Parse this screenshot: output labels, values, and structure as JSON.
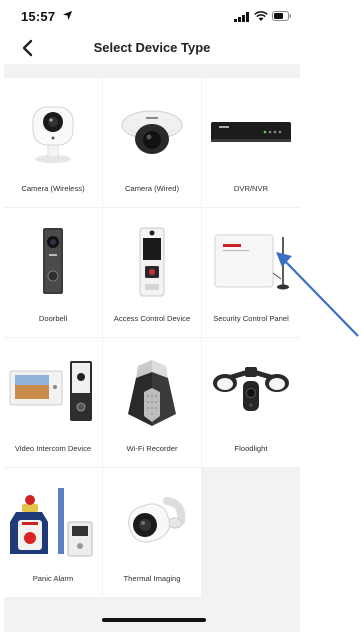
{
  "status_bar": {
    "time": "15:57",
    "location_icon": "location-arrow-icon",
    "signal_icon": "cellular-signal-icon",
    "wifi_icon": "wifi-icon",
    "battery_icon": "battery-icon"
  },
  "nav": {
    "back_icon": "chevron-left-icon",
    "title": "Select Device Type"
  },
  "devices": [
    {
      "label": "Camera (Wireless)",
      "icon": "wireless-camera-icon"
    },
    {
      "label": "Camera (Wired)",
      "icon": "dome-camera-icon"
    },
    {
      "label": "DVR/NVR",
      "icon": "dvr-nvr-icon"
    },
    {
      "label": "Doorbell",
      "icon": "doorbell-icon"
    },
    {
      "label": "Access Control Device",
      "icon": "access-control-icon"
    },
    {
      "label": "Security Control Panel",
      "icon": "security-control-panel-icon"
    },
    {
      "label": "Video Intercom Device",
      "icon": "video-intercom-icon"
    },
    {
      "label": "Wi-Fi Recorder",
      "icon": "wifi-recorder-icon"
    },
    {
      "label": "Floodlight",
      "icon": "floodlight-icon"
    },
    {
      "label": "Panic Alarm",
      "icon": "panic-alarm-icon"
    },
    {
      "label": "Thermal Imaging",
      "icon": "thermal-imaging-icon"
    }
  ],
  "colors": {
    "background": "#f2f2f2",
    "tile": "#ffffff",
    "annotation_arrow": "#3a6fc6"
  }
}
